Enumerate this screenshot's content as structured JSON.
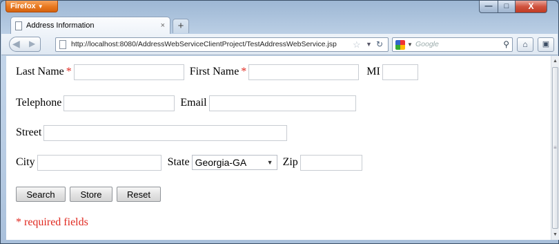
{
  "window": {
    "app_menu_label": "Firefox",
    "controls": {
      "minimize": "—",
      "maximize": "□",
      "close": "X"
    }
  },
  "tab": {
    "title": "Address Information",
    "close": "×",
    "new_tab": "+"
  },
  "nav": {
    "url": "http://localhost:8080/AddressWebServiceClientProject/TestAddressWebService.jsp",
    "search_placeholder": "Google",
    "icons": [
      "back-icon",
      "forward-icon",
      "page-icon",
      "bookmark-star-icon",
      "reload-icon",
      "search-engine-icon",
      "magnifier-icon",
      "home-icon",
      "addon-icon"
    ]
  },
  "form": {
    "last_name_label": "Last Name",
    "first_name_label": "First Name",
    "mi_label": "MI",
    "required_marker": "*",
    "telephone_label": "Telephone",
    "email_label": "Email",
    "street_label": "Street",
    "city_label": "City",
    "state_label": "State",
    "state_selected": "Georgia-GA",
    "zip_label": "Zip",
    "buttons": {
      "search": "Search",
      "store": "Store",
      "reset": "Reset"
    },
    "required_note": "* required fields",
    "values": {
      "last_name": "",
      "first_name": "",
      "mi": "",
      "telephone": "",
      "email": "",
      "street": "",
      "city": "",
      "zip": ""
    }
  },
  "colors": {
    "required": "#e0281f",
    "firefox_button": "#e8781f"
  }
}
